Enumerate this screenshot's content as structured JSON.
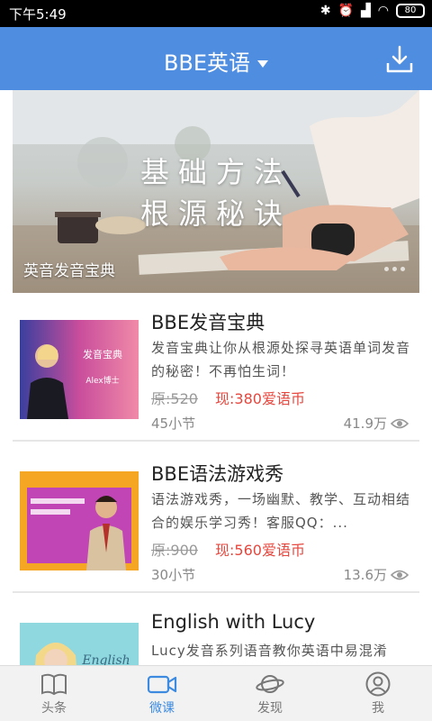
{
  "status_bar": {
    "time": "下午5:49",
    "battery": "80"
  },
  "header": {
    "title": "BBE英语"
  },
  "banner": {
    "line1": "基础方法",
    "line2": "根源秘诀",
    "caption": "英音发音宝典"
  },
  "courses": [
    {
      "title": "BBE发音宝典",
      "description": "发音宝典让你从根源处探寻英语单词发音的秘密！不再怕生词！",
      "price_old": "原:520",
      "price_new": "现:380爱语币",
      "lessons": "45小节",
      "views": "41.9万",
      "thumb_line1": "发音宝典",
      "thumb_line2": "Alex博士"
    },
    {
      "title": "BBE语法游戏秀",
      "description": "语法游戏秀，一场幽默、教学、互动相结合的娱乐学习秀！客服QQ：...",
      "price_old": "原:900",
      "price_new": "现:560爱语币",
      "lessons": "30小节",
      "views": "13.6万"
    },
    {
      "title": "English with Lucy",
      "description": "Lucy发音系列语音教你英语中易混淆",
      "thumb_text": "English"
    }
  ],
  "tabs": [
    {
      "label": "头条",
      "icon": "book-icon"
    },
    {
      "label": "微课",
      "icon": "video-camera-icon"
    },
    {
      "label": "发现",
      "icon": "planet-icon"
    },
    {
      "label": "我",
      "icon": "person-icon"
    }
  ],
  "colors": {
    "header": "#4e8de0",
    "price": "#e5473e",
    "active_tab": "#3c8be0"
  }
}
